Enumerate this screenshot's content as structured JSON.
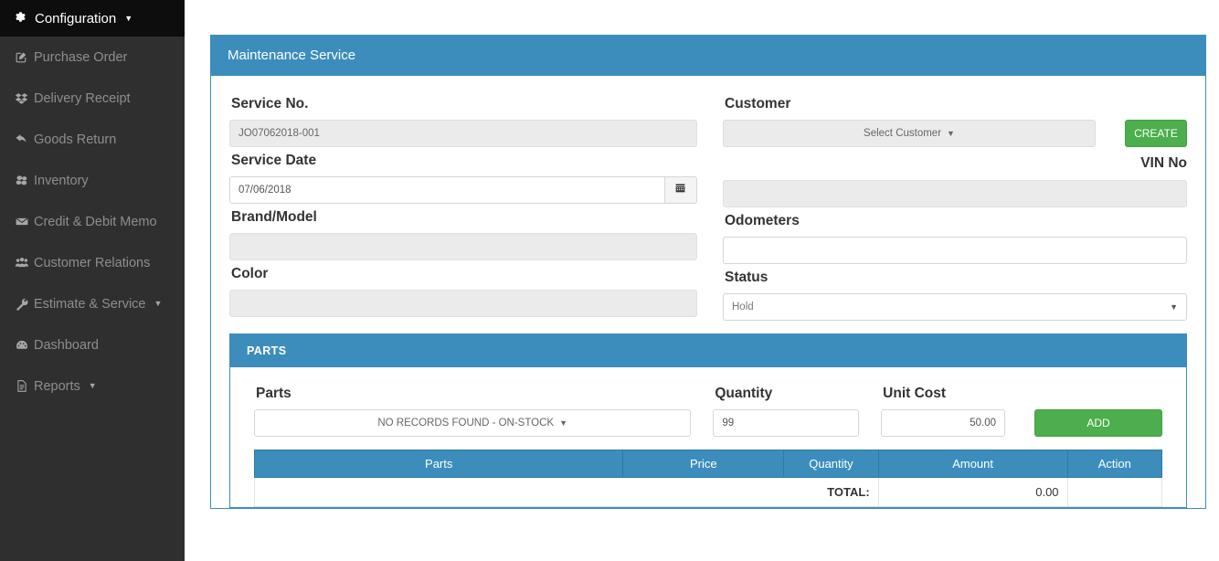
{
  "sidebar": {
    "header": {
      "label": "Configuration",
      "icon": "gear-icon",
      "caret": "▼"
    },
    "items": [
      {
        "label": "Purchase Order",
        "icon": "edit-square-icon",
        "caret": ""
      },
      {
        "label": "Delivery Receipt",
        "icon": "dropbox-icon",
        "caret": ""
      },
      {
        "label": "Goods Return",
        "icon": "reply-arrow-icon",
        "caret": ""
      },
      {
        "label": "Inventory",
        "icon": "cubes-icon",
        "caret": ""
      },
      {
        "label": "Credit & Debit Memo",
        "icon": "envelope-icon",
        "caret": ""
      },
      {
        "label": "Customer Relations",
        "icon": "users-icon",
        "caret": ""
      },
      {
        "label": "Estimate & Service",
        "icon": "wrench-icon",
        "caret": "▼"
      },
      {
        "label": "Dashboard",
        "icon": "tachometer-icon",
        "caret": ""
      },
      {
        "label": "Reports",
        "icon": "file-text-icon",
        "caret": "▼"
      }
    ]
  },
  "panel": {
    "title": "Maintenance Service",
    "fields": {
      "service_no_label": "Service No.",
      "service_no_value": "JO07062018-001",
      "service_date_label": "Service Date",
      "service_date_value": "07/06/2018",
      "brand_model_label": "Brand/Model",
      "brand_model_value": "",
      "color_label": "Color",
      "color_value": "",
      "customer_label": "Customer",
      "customer_select_text": "Select Customer",
      "create_button": "CREATE",
      "vin_no_label": "VIN No",
      "vin_no_value": "",
      "odometers_label": "Odometers",
      "odometers_value": "",
      "status_label": "Status",
      "status_value": "Hold"
    }
  },
  "parts_panel": {
    "title": "PARTS",
    "parts_label": "Parts",
    "parts_select_text": "NO RECORDS FOUND - ON-STOCK",
    "quantity_label": "Quantity",
    "quantity_value": "99",
    "unit_cost_label": "Unit Cost",
    "unit_cost_value": "50.00",
    "add_button": "ADD",
    "table": {
      "headers": [
        "Parts",
        "Price",
        "Quantity",
        "Amount",
        "Action"
      ],
      "rows": [],
      "total_label": "TOTAL:",
      "total_value": "0.00"
    }
  },
  "colors": {
    "brand_blue": "#3c8dbc",
    "sidebar_dark": "#2f2f2f",
    "sidebar_header_dark": "#0d0d0d",
    "green": "#4cae4c",
    "disabled_gray": "#ebebeb"
  }
}
